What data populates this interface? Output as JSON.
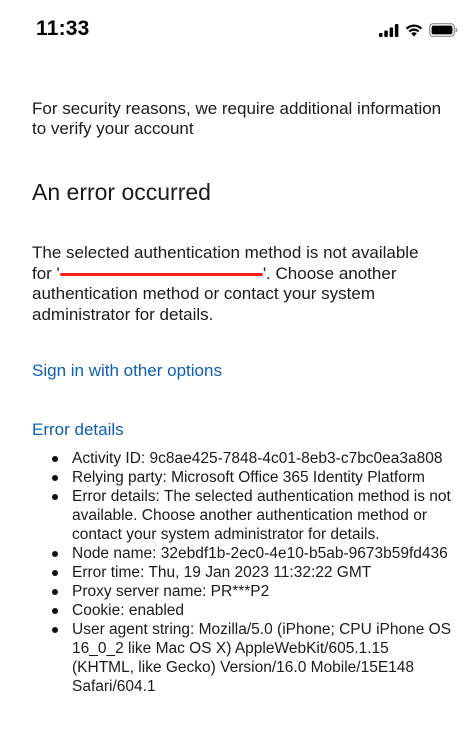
{
  "status_bar": {
    "time": "11:33",
    "icons": [
      "signal-icon",
      "wifi-icon",
      "battery-icon"
    ]
  },
  "intro": "For security reasons, we require additional information to verify your account",
  "title": "An error occurred",
  "error_message": {
    "before": "The selected authentication method is not available for '",
    "after": "'. Choose another authentication method or contact your system administrator for details."
  },
  "links": {
    "other_options": "Sign in with other options",
    "error_details": "Error details"
  },
  "error_details": [
    "Activity ID: 9c8ae425-7848-4c01-8eb3-c7bc0ea3a808",
    "Relying party: Microsoft Office 365 Identity Platform",
    "Error details: The selected authentication method is not available. Choose another authentication method or contact your system administrator for details.",
    "Node name: 32ebdf1b-2ec0-4e10-b5ab-9673b59fd436",
    "Error time: Thu, 19 Jan 2023 11:32:22 GMT",
    "Proxy server name: PR***P2",
    "Cookie: enabled",
    "User agent string: Mozilla/5.0 (iPhone; CPU iPhone OS 16_0_2 like Mac OS X) AppleWebKit/605.1.15 (KHTML, like Gecko) Version/16.0 Mobile/15E148 Safari/604.1"
  ],
  "colors": {
    "link": "#0b5fb4",
    "redaction": "#ff1f1f",
    "text": "#1b1b1b"
  }
}
